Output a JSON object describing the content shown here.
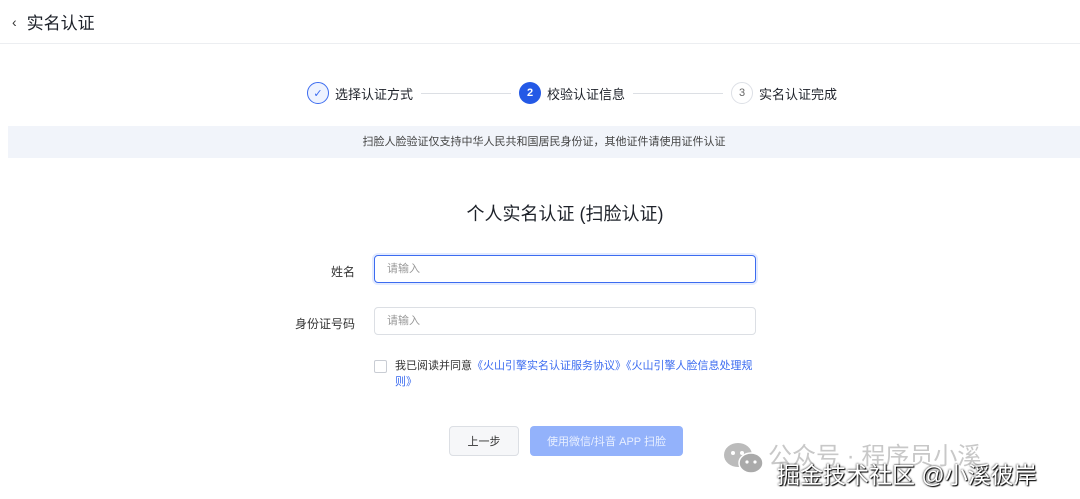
{
  "header": {
    "back_icon": "chevron-left-icon",
    "title": "实名认证"
  },
  "steps": [
    {
      "num": "✓",
      "label": "选择认证方式"
    },
    {
      "num": "2",
      "label": "校验认证信息"
    },
    {
      "num": "3",
      "label": "实名认证完成"
    }
  ],
  "banner": "扫脸人脸验证仅支持中华人民共和国居民身份证，其他证件请使用证件认证",
  "form": {
    "title": "个人实名认证 (扫脸认证)",
    "name_label": "姓名",
    "name_placeholder": "请输入",
    "id_label": "身份证号码",
    "id_placeholder": "请输入",
    "agree_text": "我已阅读并同意",
    "link1": "《火山引擎实名认证服务协议》",
    "link2": "《火山引擎人脸信息处理规则》"
  },
  "buttons": {
    "prev": "上一步",
    "scan": "使用微信/抖音 APP 扫脸"
  },
  "watermark": {
    "line1": "公众号 · 程序员小溪",
    "line2": "掘金技术社区 @小溪彼岸"
  }
}
